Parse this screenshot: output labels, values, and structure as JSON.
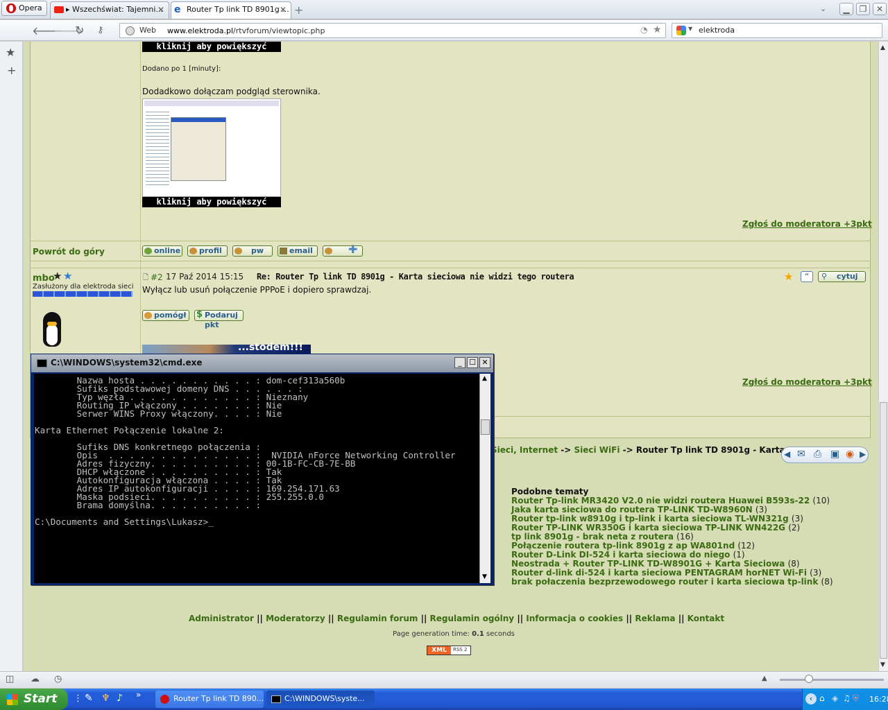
{
  "browser": {
    "opera_label": "Opera",
    "tabs": [
      {
        "label": "▸ Wszechświat: Tajemni...",
        "active": false
      },
      {
        "label": "Router Tp link TD 8901g ...",
        "active": true
      }
    ],
    "address": {
      "mode": "Web",
      "url_domain": "www.elektroda.pl",
      "url_path": "/rtvforum/viewtopic.php"
    },
    "search": {
      "value": "elektroda"
    }
  },
  "post1": {
    "caption1": "kliknij aby powiększyć",
    "added": "Dodano po 1 [minuty]:",
    "text": "Dodadkowo dołączam podgląd sterownika.",
    "caption2": "kliknij aby powiększyć",
    "report": "Zgłoś do moderatora +3pkt",
    "back_top": "Powrót do góry",
    "buttons": [
      "online",
      "profil",
      "pw",
      "email",
      ""
    ]
  },
  "post2": {
    "author": "mbo",
    "rank": "Zasłużony dla elektroda sieci",
    "number": "#2",
    "date": "17 Paź 2014 15:15",
    "title": "Re: Router Tp link TD 8901g - Karta sieciowa nie widzi tego routera",
    "quote": "cytuj",
    "text": "Wyłącz lub usuń połączenie PPPoE i dopiero sprawdzaj.",
    "helped": "pomógł",
    "give_points": "Podaruj pkt",
    "banner": "...stodem!!!",
    "report": "Zgłoś do moderatora +3pkt"
  },
  "breadcrumb": {
    "part1": "Sieci, Internet",
    "sep": "->",
    "part2": "Sieci WiFi",
    "current": "Router Tp link TD 8901g - Karta"
  },
  "similar": {
    "heading": "Podobne tematy",
    "items": [
      {
        "title": "Router Tp-link MR3420 V2.0 nie widzi routera Huawei B593s-22",
        "count": "(10)"
      },
      {
        "title": "Jaka karta sieciowa do routera TP-LINK TD-W8960N",
        "count": "(3)"
      },
      {
        "title": "Router tp-link w8910g i tp-link i karta sieciowa TL-WN321g",
        "count": "(3)"
      },
      {
        "title": "Router TP-LINK WR350G i karta sieciowa TP-LINK WN422G",
        "count": "(2)"
      },
      {
        "title": "tp link 8901g - brak neta z routera",
        "count": "(16)"
      },
      {
        "title": "Połączenie routera tp-link 8901g z ap WA801nd",
        "count": "(12)"
      },
      {
        "title": "Router D-Link DI-524 i karta sieciowa do niego",
        "count": "(1)"
      },
      {
        "title": "Neostrada + Router TP-LINK TD-W8901G + Karta Sieciowa",
        "count": "(8)"
      },
      {
        "title": "Router d-link di-524 i karta sieciowa PENTAGRAM horNET Wi-Fi",
        "count": "(3)"
      },
      {
        "title": "brak połaczenia bezprzewodowego router i karta sieciowa tp-link",
        "count": "(8)"
      }
    ]
  },
  "footer": {
    "links": [
      "Administrator",
      "Moderatorzy",
      "Regulamin forum",
      "Regulamin ogólny",
      "Informacja o cookies",
      "Reklama",
      "Kontakt"
    ],
    "sep": "||",
    "gen_label": "Page generation time:",
    "gen_value": "0.1",
    "gen_unit": "seconds",
    "xml": "XML",
    "rss": "RSS 2"
  },
  "cmd": {
    "title": "C:\\WINDOWS\\system32\\cmd.exe",
    "lines": [
      "        Nazwa hosta . . . . . . . . . . . : dom-cef313a560b",
      "        Sufiks podstawowej domeny DNS . . . . . . :",
      "        Typ węzła . . . . . . . . . . . . : Nieznany",
      "        Routing IP włączony . . . . . . . : Nie",
      "        Serwer WINS Proxy włączony. . . . : Nie",
      "",
      "Karta Ethernet Połączenie lokalne 2:",
      "",
      "        Sufiks DNS konkretnego połączenia :",
      "        Opis  . . . . . . . . . . . . . . :  NVIDIA nForce Networking Controller",
      "        Adres fizyczny. . . . . . . . . . : 00-1B-FC-CB-7E-BB",
      "        DHCP włączone . . . . . . . . . . : Tak",
      "        Autokonfiguracja włączona . . . . : Tak",
      "        Adres IP autokonfiguracji . . . . : 169.254.171.63",
      "        Maska podsieci. . . . . . . . . . : 255.255.0.0",
      "        Brama domyślna. . . . . . . . . . :",
      "",
      "C:\\Documents and Settings\\Lukasz>_"
    ]
  },
  "taskbar": {
    "start": "Start",
    "items": [
      "Router Tp link TD 890...",
      "C:\\WINDOWS\\syste..."
    ],
    "clock": "16:28"
  }
}
